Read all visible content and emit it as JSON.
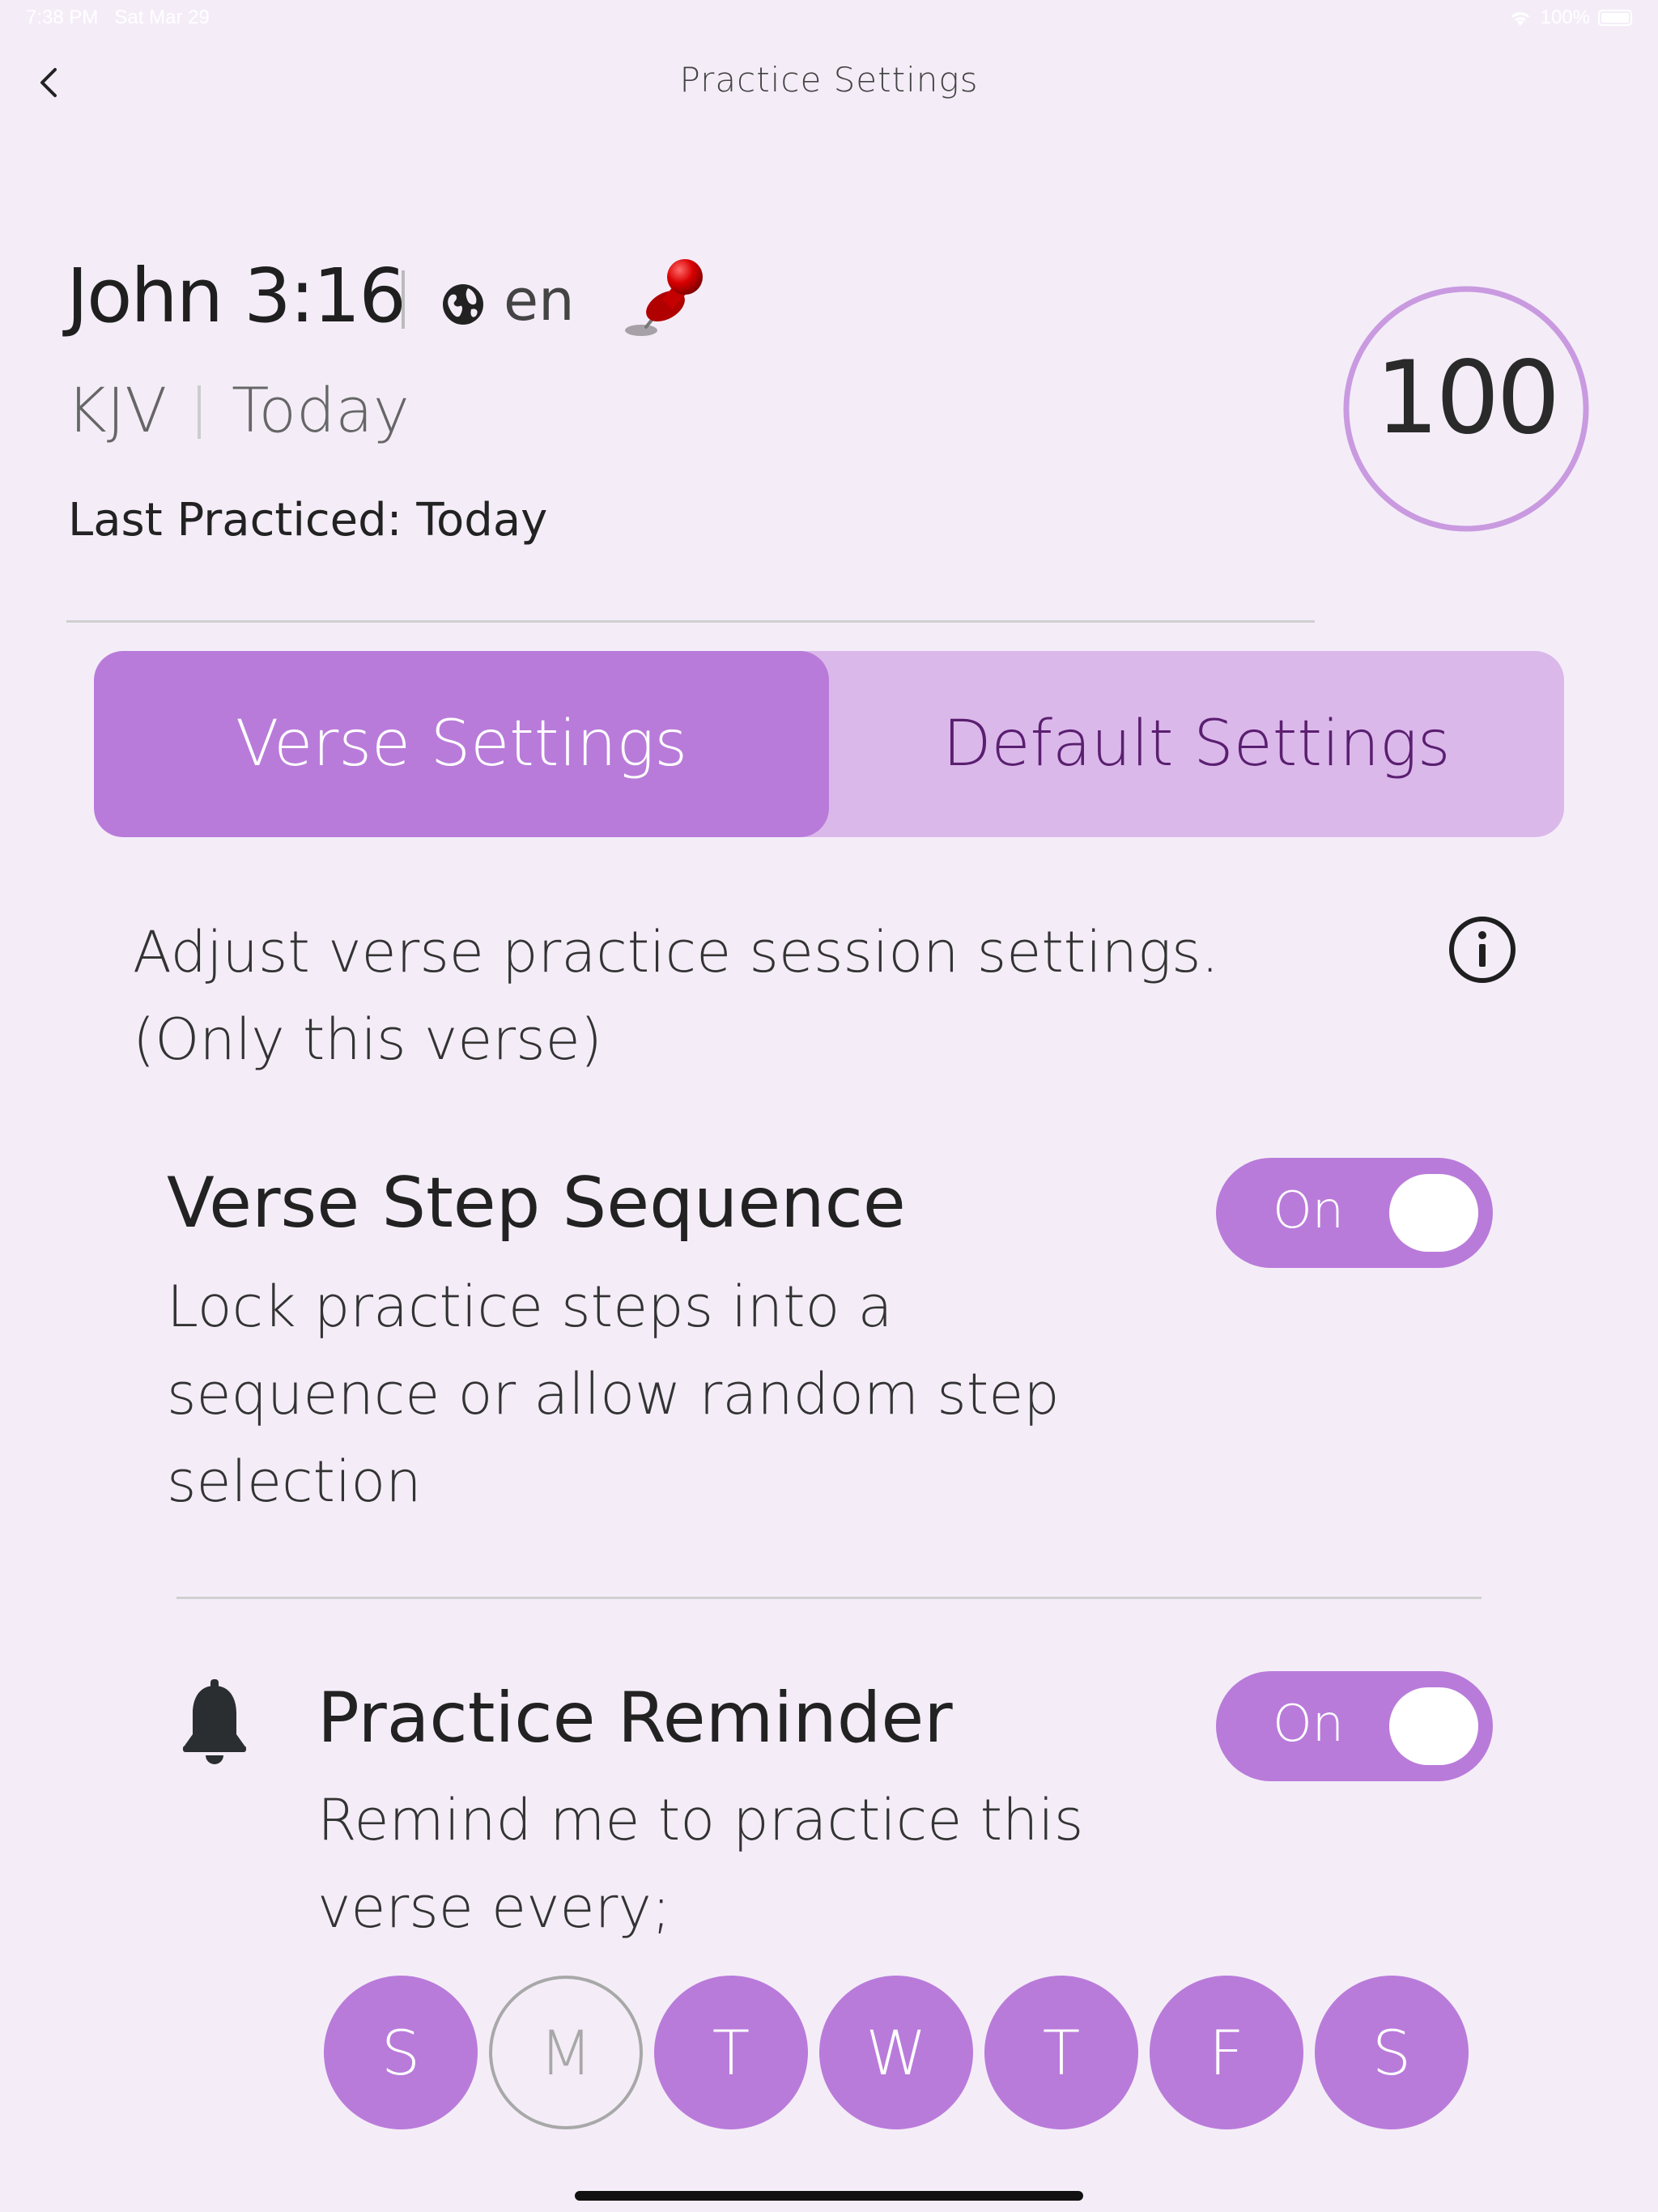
{
  "status_bar": {
    "time": "7:38 PM",
    "date": "Sat Mar 29",
    "battery": "100%"
  },
  "nav": {
    "title": "Practice Settings"
  },
  "verse": {
    "reference": "John 3:16",
    "language": "en",
    "version": "KJV",
    "date": "Today",
    "last_practiced": "Last Practiced: Today",
    "score": "100"
  },
  "tabs": [
    {
      "label": "Verse Settings",
      "active": true
    },
    {
      "label": "Default Settings",
      "active": false
    }
  ],
  "description": "Adjust verse practice session settings. (Only this verse)",
  "settings": {
    "step_sequence": {
      "title": "Verse Step Sequence",
      "description": "Lock practice steps into a sequence or allow random step selection",
      "toggle_label": "On"
    },
    "reminder": {
      "title": "Practice Reminder",
      "description": "Remind me to practice this verse every;",
      "toggle_label": "On",
      "days": [
        {
          "label": "S",
          "selected": true
        },
        {
          "label": "M",
          "selected": false
        },
        {
          "label": "T",
          "selected": true
        },
        {
          "label": "W",
          "selected": true
        },
        {
          "label": "T",
          "selected": true
        },
        {
          "label": "F",
          "selected": true
        },
        {
          "label": "S",
          "selected": true
        }
      ]
    }
  },
  "colors": {
    "accent": "#b97bda",
    "accent_light": "#dbb8ea",
    "background": "#f4edf8",
    "tab_inactive_text": "#5a1f70"
  },
  "icons": {
    "back": "chevron-left-icon",
    "language": "globe-icon",
    "pin": "pushpin-icon",
    "info": "info-icon",
    "reminder": "bell-icon"
  }
}
